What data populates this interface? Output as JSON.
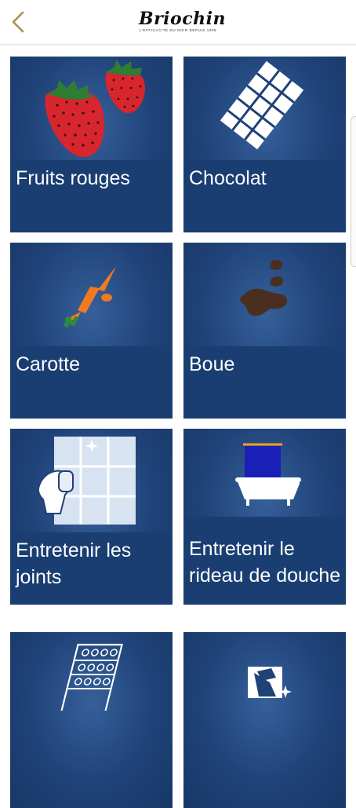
{
  "header": {
    "back_icon": "chevron-left-icon",
    "logo_text": "Briochin",
    "logo_tagline": "L'EFFICACITÉ DU NOIR DEPUIS 1908",
    "accent_color": "#b08d4a"
  },
  "tiles": [
    {
      "label": "Fruits rouges",
      "icon": "strawberry-icon"
    },
    {
      "label": "Chocolat",
      "icon": "chocolate-bar-icon"
    },
    {
      "label": "Carotte",
      "icon": "carrot-icon"
    },
    {
      "label": "Boue",
      "icon": "mud-stain-icon"
    },
    {
      "label": "Entretenir les joints",
      "icon": "window-cleaning-icon"
    },
    {
      "label": "Entretenir le rideau de douche",
      "icon": "bathtub-curtain-icon"
    },
    {
      "label": "",
      "icon": "oven-icon"
    },
    {
      "label": "",
      "icon": "cleaning-icon"
    }
  ],
  "colors": {
    "tile_bg": "#1f4278",
    "label_band": "#1a3e72",
    "text": "#ffffff"
  }
}
